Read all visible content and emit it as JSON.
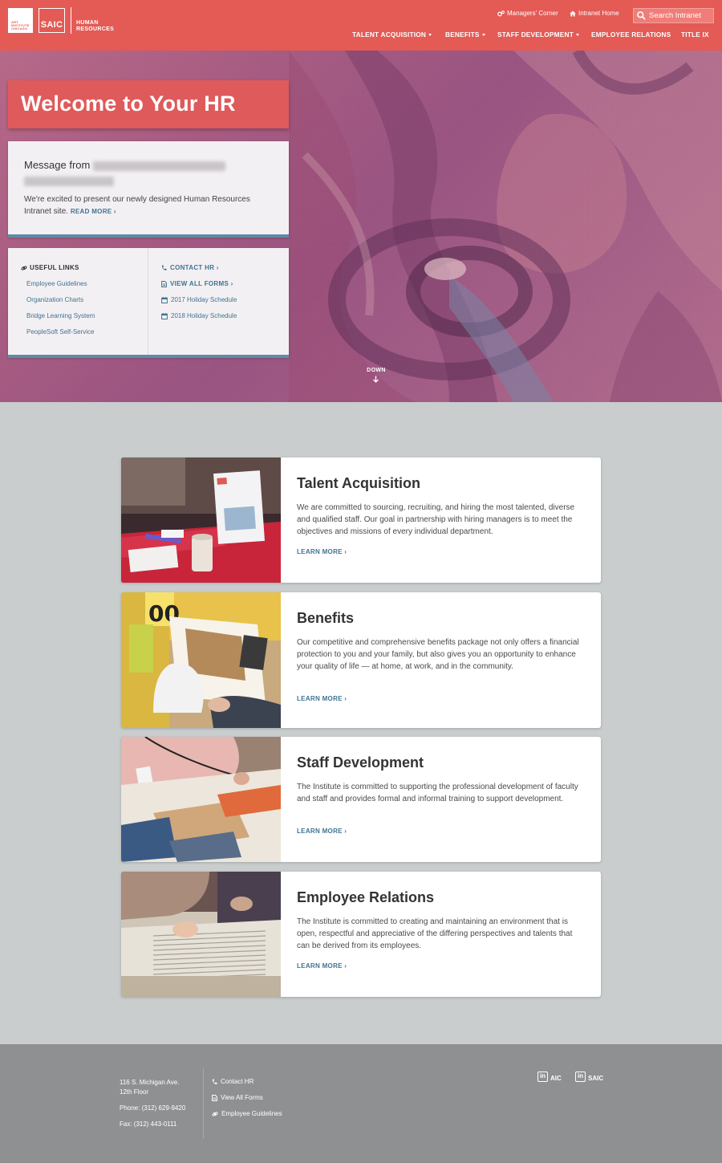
{
  "header": {
    "logo_aic_lines": [
      "ART",
      "INSTITUTE",
      "CHICAGO"
    ],
    "logo_saic": "SAIC",
    "logo_hr_lines": [
      "HUMAN",
      "RESOURCES"
    ],
    "util_links": [
      {
        "label": "Managers' Corner",
        "icon": "cogs-icon"
      },
      {
        "label": "Intranet Home",
        "icon": "home-icon"
      }
    ],
    "search_placeholder": "Search Intranet",
    "nav": [
      {
        "label": "TALENT ACQUISITION",
        "dropdown": true
      },
      {
        "label": "BENEFITS",
        "dropdown": true
      },
      {
        "label": "STAFF DEVELOPMENT",
        "dropdown": true
      },
      {
        "label": "EMPLOYEE RELATIONS",
        "dropdown": false
      },
      {
        "label": "TITLE IX",
        "dropdown": false
      }
    ]
  },
  "hero": {
    "title": "Welcome to Your HR",
    "message": {
      "title_prefix": "Message from",
      "body": "We're excited to present our newly designed Human Resources Intranet site.",
      "read_more": "READ MORE ›"
    },
    "useful_links": {
      "heading": "USEFUL LINKS",
      "items": [
        "Employee Guidelines",
        "Organization Charts",
        "Bridge Learning System",
        "PeopleSoft Self-Service"
      ]
    },
    "quick_links": [
      {
        "label": "CONTACT HR ›",
        "icon": "phone-icon",
        "strong": true
      },
      {
        "label": "VIEW ALL FORMS ›",
        "icon": "document-icon",
        "strong": true
      },
      {
        "label": "2017 Holiday Schedule",
        "icon": "calendar-icon",
        "strong": false
      },
      {
        "label": "2018 Holiday Schedule",
        "icon": "calendar-icon",
        "strong": false
      }
    ],
    "down_label": "DOWN"
  },
  "cards": [
    {
      "title": "Talent Acquisition",
      "text": "We are committed to sourcing, recruiting, and hiring the most talented, diverse and qualified staff. Our goal in partnership with hiring managers is to meet the objectives and missions of every individual department.",
      "link": "LEARN MORE ›"
    },
    {
      "title": "Benefits",
      "text": "Our competitive and comprehensive benefits package not only offers a financial protection to you and your family, but also gives you an opportunity to enhance your quality of life — at home, at work, and in the community.",
      "link": "LEARN MORE ›"
    },
    {
      "title": "Staff Development",
      "text": "The Institute is committed to supporting the professional development of faculty and staff and provides formal and informal training to support development.",
      "link": "LEARN MORE ›"
    },
    {
      "title": "Employee Relations",
      "text": "The Institute is committed to creating and maintaining an environment that is open, respectful and appreciative of the differing perspectives and talents that can be derived from its employees.",
      "link": "LEARN MORE ›"
    }
  ],
  "footer": {
    "address_lines": [
      "116 S. Michigan Ave.",
      "12th Floor"
    ],
    "phone": "Phone: (312) 629-9420",
    "fax": "Fax: (312) 443-0111",
    "links": [
      {
        "label": "Contact HR",
        "icon": "phone-icon"
      },
      {
        "label": "View All Forms",
        "icon": "document-icon"
      },
      {
        "label": "Employee Guidelines",
        "icon": "link-icon"
      }
    ],
    "social": [
      {
        "label": "AIC",
        "icon": "linkedin-icon",
        "icon_text": "in"
      },
      {
        "label": "SAIC",
        "icon": "linkedin-icon",
        "icon_text": "in"
      }
    ]
  },
  "colors": {
    "brand_red": "#e45a55",
    "link_blue": "#3f7392",
    "accent_teal": "#5b8da6",
    "page_bg": "#c9cdcd",
    "footer_bg": "#8f9092"
  }
}
